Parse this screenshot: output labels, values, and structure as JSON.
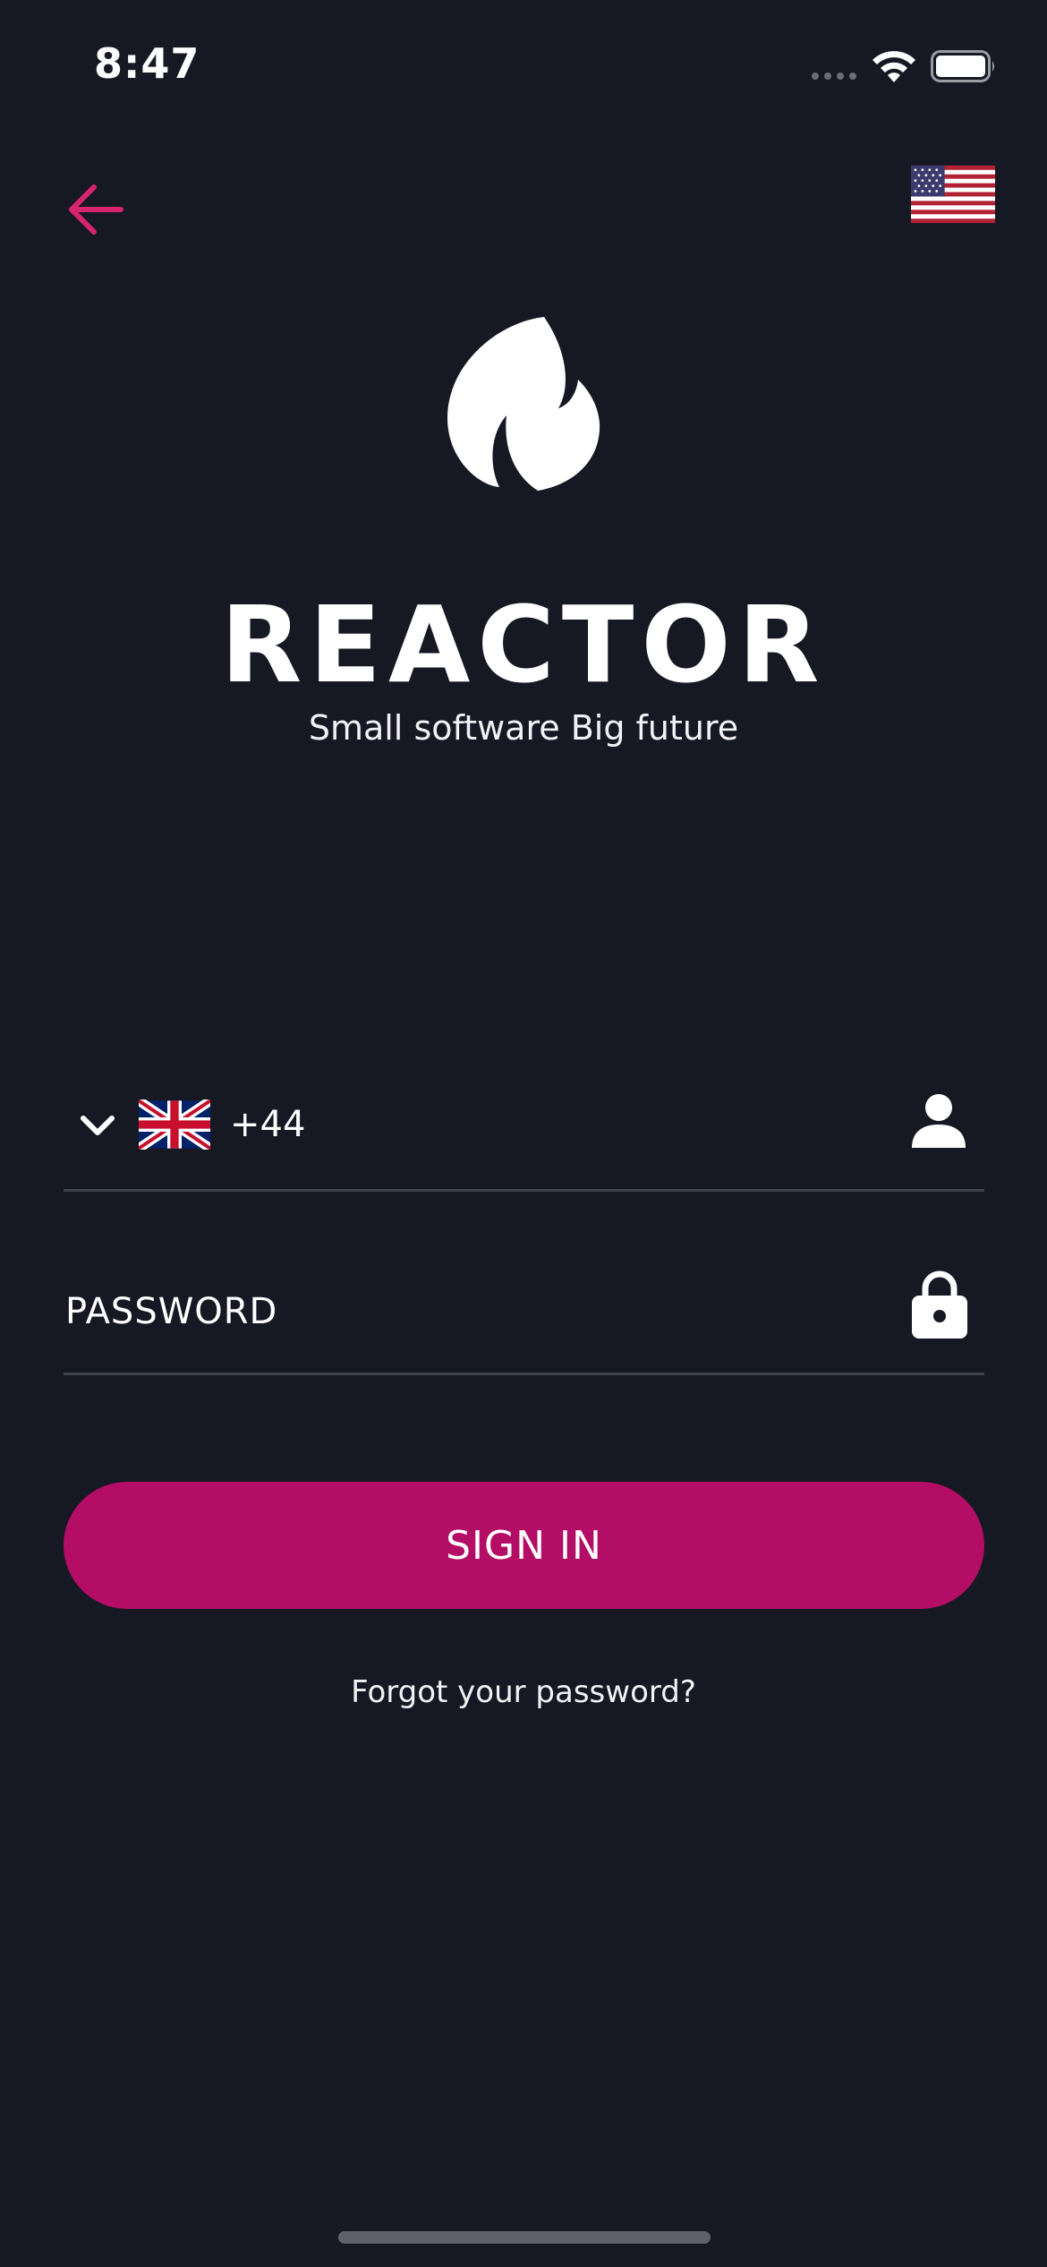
{
  "status_bar": {
    "time": "8:47",
    "icons": [
      "signal-dots-icon",
      "wifi-icon",
      "battery-icon"
    ]
  },
  "nav": {
    "back_icon": "arrow-left-icon",
    "language_flag": "us-flag-icon"
  },
  "brand": {
    "logo_icon": "flame-icon",
    "title": "REACTOR",
    "tagline": "Small software Big future"
  },
  "login_form": {
    "phone": {
      "country_flag": "uk-flag-icon",
      "country_code": "+44",
      "value": "",
      "trailing_icon": "user-icon"
    },
    "password": {
      "placeholder": "PASSWORD",
      "value": "",
      "trailing_icon": "lock-icon"
    },
    "sign_in_label": "SIGN IN",
    "forgot_password_label": "Forgot your password?"
  },
  "colors": {
    "background": "#161824",
    "accent": "#b30d65",
    "back_arrow": "#d6246e",
    "divider": "#3f424f"
  }
}
